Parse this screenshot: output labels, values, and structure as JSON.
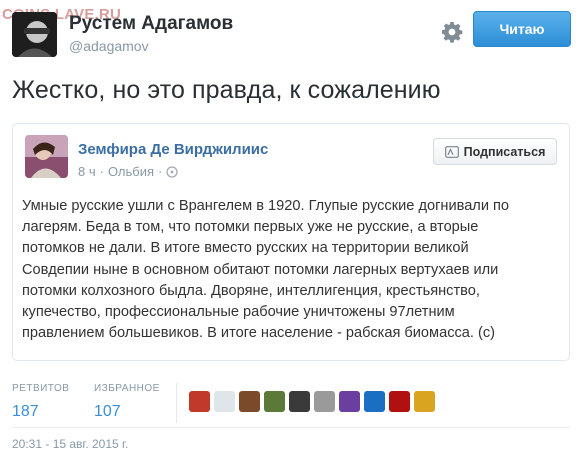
{
  "watermark": "COINS.LAVE.RU",
  "author": {
    "name": "Рустем Адагамов",
    "handle": "@adagamov",
    "avatar_icon": "user-avatar"
  },
  "header": {
    "settings_icon": "gear-icon",
    "follow_label": "Читаю",
    "accent_color": "#2d8fd6"
  },
  "tweet": {
    "text": "Жестко, но это правда, к сожалению"
  },
  "quoted": {
    "name": "Земфира Де Вирджилиис",
    "time": "8 ч",
    "separator": "·",
    "location": "Ольбия",
    "lock_icon": "lock-icon",
    "subscribe_label": "Подписаться",
    "body_lines": [
      "Умные русские ушли с Врангелем в 1920. Глупые русские догнивали по",
      "лагерям. Беда в том, что потомки первых уже не русские, а вторые",
      "потомков не дали. В итоге вместо русских на территории великой",
      "Совдепии ныне в основном обитают потомки лагерных вертухаев или",
      "потомки колхозного быдла. Дворяне, интеллигенция, крестьянство,",
      "купечество, профессиональные рабочие уничтожены 97летним",
      "правлением большевиков. В итоге население - рабская биомасса. (с)"
    ]
  },
  "stats": {
    "retweets_label": "РЕТВИТОВ",
    "retweets_value": "187",
    "favorites_label": "ИЗБРАННОЕ",
    "favorites_value": "107"
  },
  "favorited_by_colors": [
    "#c0392b",
    "#dfe6ea",
    "#7a4a2a",
    "#5b7a3a",
    "#3a3a3a",
    "#9a9a9a",
    "#6b3fa0",
    "#1b6fc2",
    "#b01010",
    "#d9a520"
  ],
  "timestamp": "20:31 - 15 авг. 2015 г."
}
